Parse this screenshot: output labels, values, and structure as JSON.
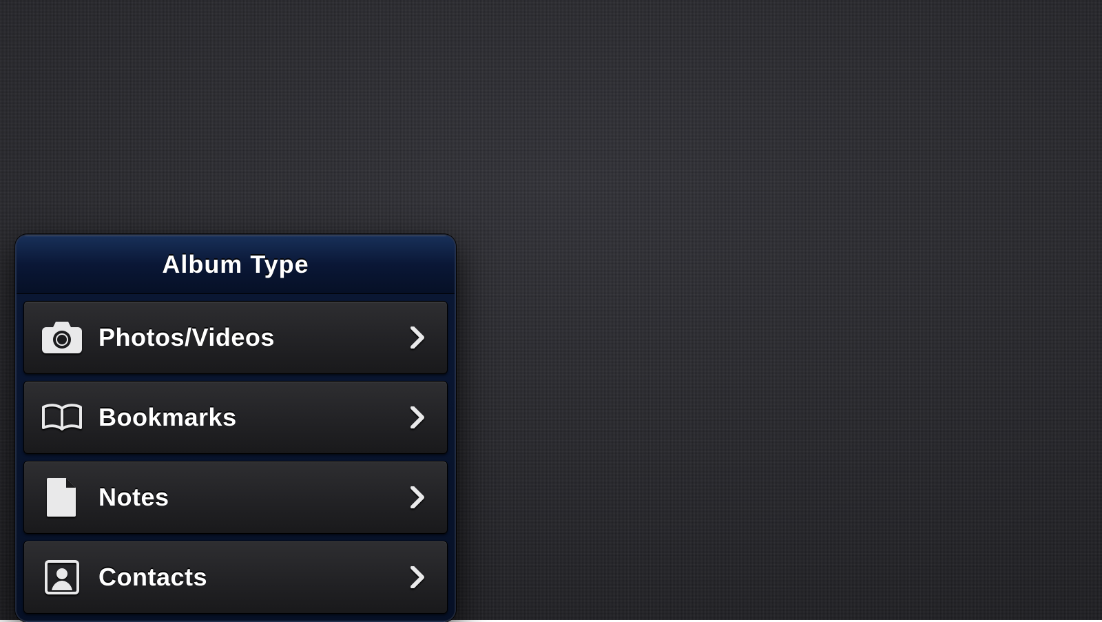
{
  "popover": {
    "title": "Album Type",
    "items": [
      {
        "icon": "camera-icon",
        "label": "Photos/Videos"
      },
      {
        "icon": "book-icon",
        "label": "Bookmarks"
      },
      {
        "icon": "document-icon",
        "label": "Notes"
      },
      {
        "icon": "contact-icon",
        "label": "Contacts"
      }
    ]
  },
  "colors": {
    "popover_header_top": "#183059",
    "popover_header_bottom": "#061026",
    "row_top": "#2e2e31",
    "row_bottom": "#19191b",
    "text": "#ffffff"
  }
}
